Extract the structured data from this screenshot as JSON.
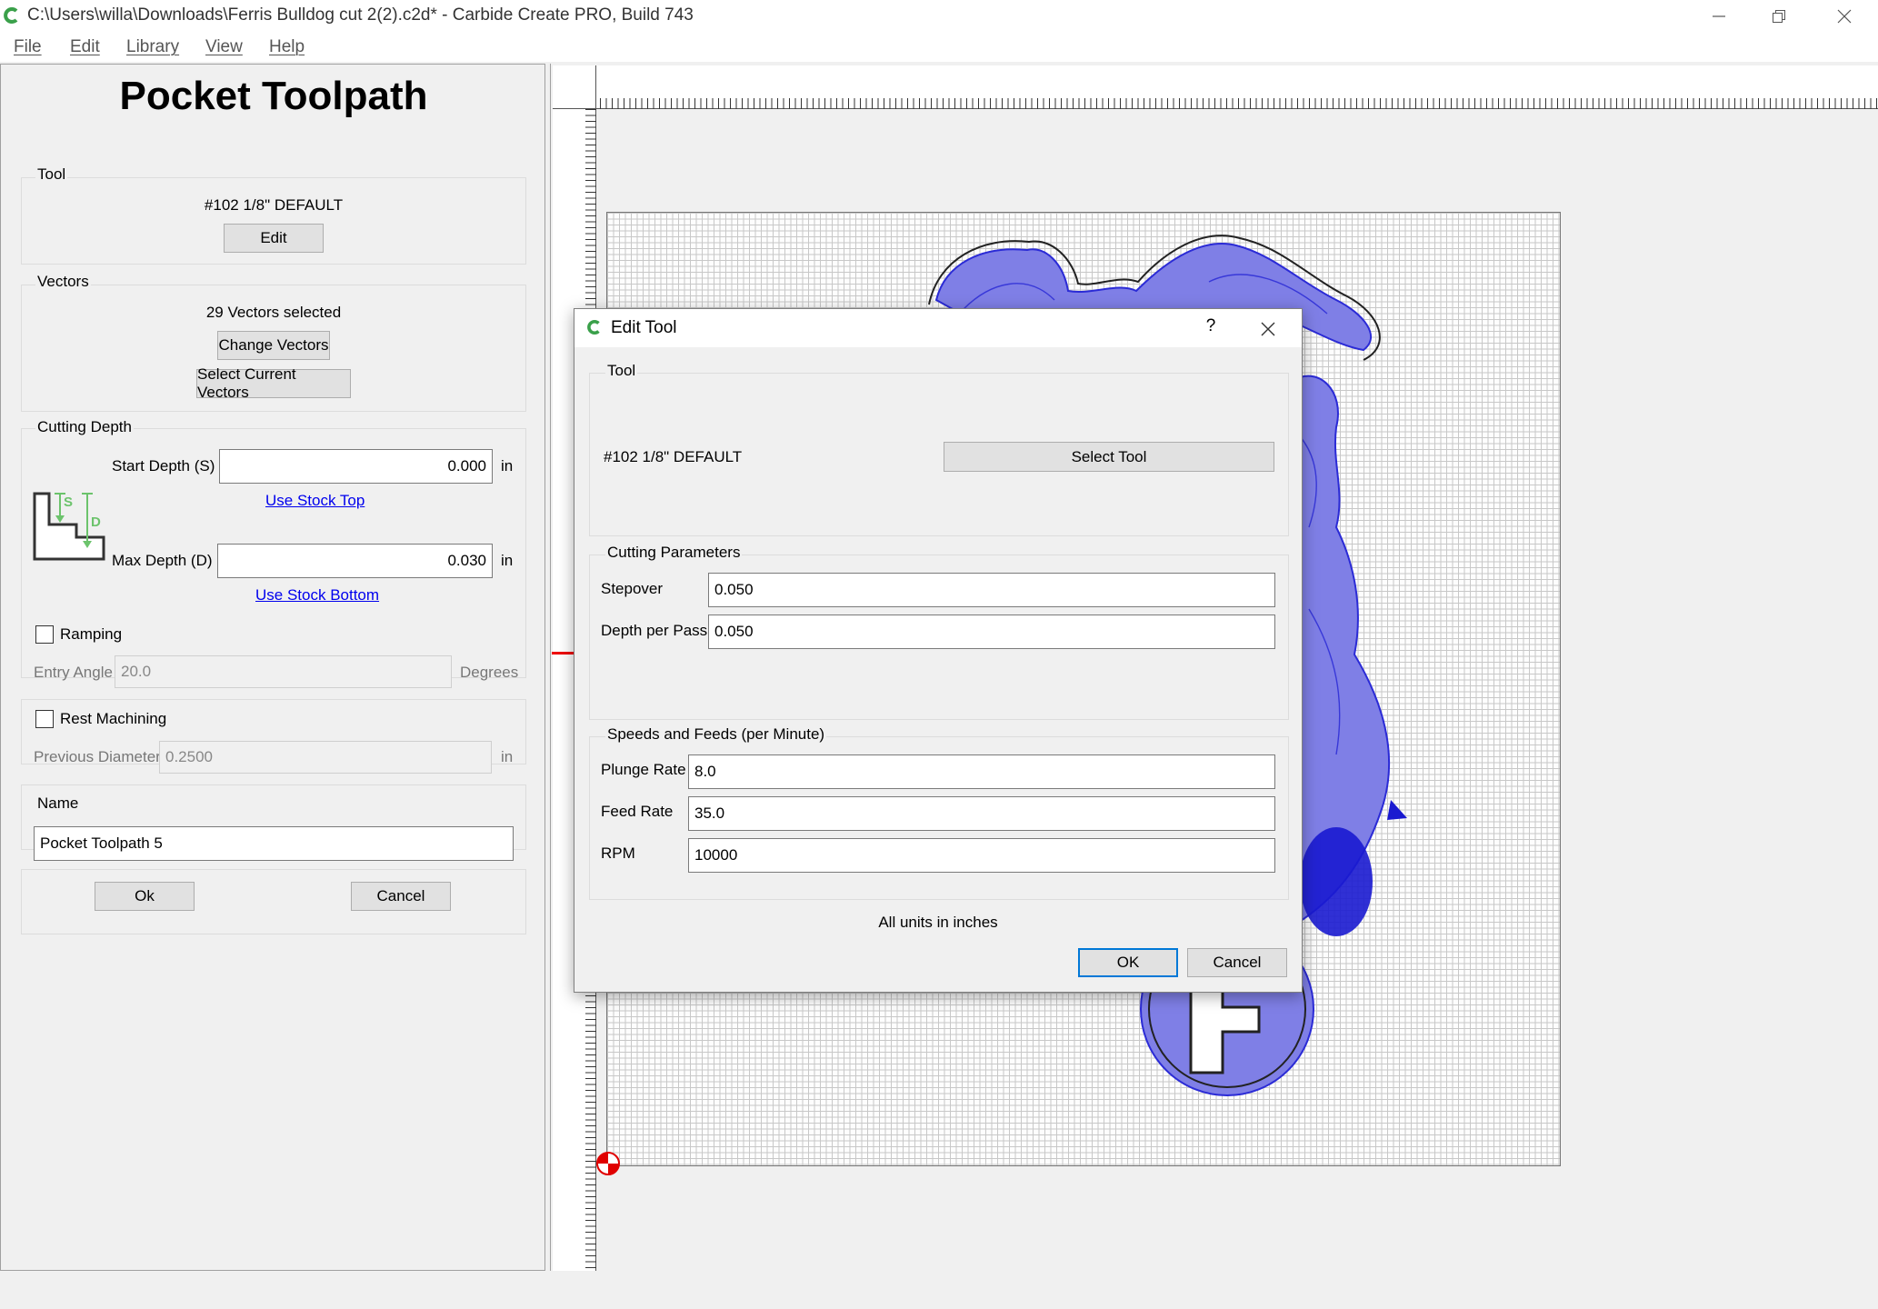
{
  "window": {
    "title": "C:\\Users\\willa\\Downloads\\Ferris Bulldog cut 2(2).c2d* - Carbide Create PRO, Build 743",
    "controls": {
      "minimize": "minimize-icon",
      "maximize": "restore-icon",
      "close": "close-icon"
    }
  },
  "menu": {
    "items": [
      "File",
      "Edit",
      "Library",
      "View",
      "Help"
    ]
  },
  "panel": {
    "title": "Pocket Toolpath",
    "tool": {
      "label": "Tool",
      "name": "#102 1/8\" DEFAULT",
      "edit_button": "Edit"
    },
    "vectors": {
      "label": "Vectors",
      "selected_text": "29 Vectors selected",
      "change_button": "Change Vectors",
      "select_current_button": "Select Current Vectors"
    },
    "cutting_depth": {
      "label": "Cutting Depth",
      "start_label": "Start Depth (S)",
      "start_value": "0.000",
      "start_unit": "in",
      "use_stock_top": "Use Stock Top",
      "max_label": "Max Depth (D)",
      "max_value": "0.030",
      "max_unit": "in",
      "use_stock_bottom": "Use Stock Bottom",
      "diagram_s": "S",
      "diagram_d": "D"
    },
    "ramping": {
      "label": "Ramping",
      "checked": false,
      "entry_angle_label": "Entry Angle",
      "entry_angle_value": "20.0",
      "unit": "Degrees"
    },
    "rest_machining": {
      "label": "Rest Machining",
      "checked": false,
      "prev_diameter_label": "Previous Diameter",
      "prev_diameter_value": "0.2500",
      "unit": "in"
    },
    "name": {
      "label": "Name",
      "value": "Pocket Toolpath 5"
    },
    "ok_button": "Ok",
    "cancel_button": "Cancel"
  },
  "dialog": {
    "title": "Edit Tool",
    "help": "?",
    "tool_group": {
      "label": "Tool",
      "name": "#102 1/8\" DEFAULT",
      "select_button": "Select Tool"
    },
    "cutting": {
      "label": "Cutting Parameters",
      "stepover_label": "Stepover",
      "stepover_value": "0.050",
      "depth_label": "Depth per Pass",
      "depth_value": "0.050"
    },
    "speeds": {
      "label": "Speeds and Feeds (per Minute)",
      "plunge_label": "Plunge Rate",
      "plunge_value": "8.0",
      "feed_label": "Feed Rate",
      "feed_value": "35.0",
      "rpm_label": "RPM",
      "rpm_value": "10000"
    },
    "units_note": "All units in inches",
    "ok_button": "OK",
    "cancel_button": "Cancel"
  },
  "colors": {
    "toolpath_blue": "#2b2bd6",
    "toolpath_fill": "#7f7fe6",
    "link": "#0000ee",
    "diagram_green": "#6cc36c",
    "origin_red": "#e00000"
  }
}
